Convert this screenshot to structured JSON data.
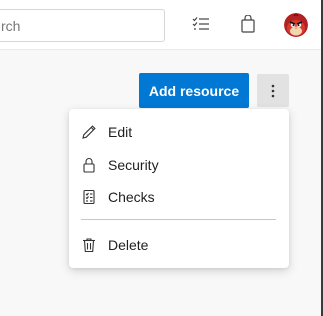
{
  "topbar": {
    "search": {
      "placeholder": "rch",
      "value": ""
    },
    "icons": {
      "task_list": "checklist-icon",
      "marketplace": "shopping-bag-icon",
      "user": "avatar"
    }
  },
  "actions": {
    "add_resource_label": "Add resource",
    "more_icon": "more-vertical-icon"
  },
  "menu": {
    "items": [
      {
        "label": "Edit",
        "icon": "pencil-icon"
      },
      {
        "label": "Security",
        "icon": "lock-icon"
      },
      {
        "label": "Checks",
        "icon": "checks-icon"
      },
      {
        "label": "Delete",
        "icon": "trash-icon"
      }
    ]
  },
  "colors": {
    "primary": "#0078d4",
    "menu_bg": "#ffffff",
    "page_bg": "#f8f8f8"
  }
}
